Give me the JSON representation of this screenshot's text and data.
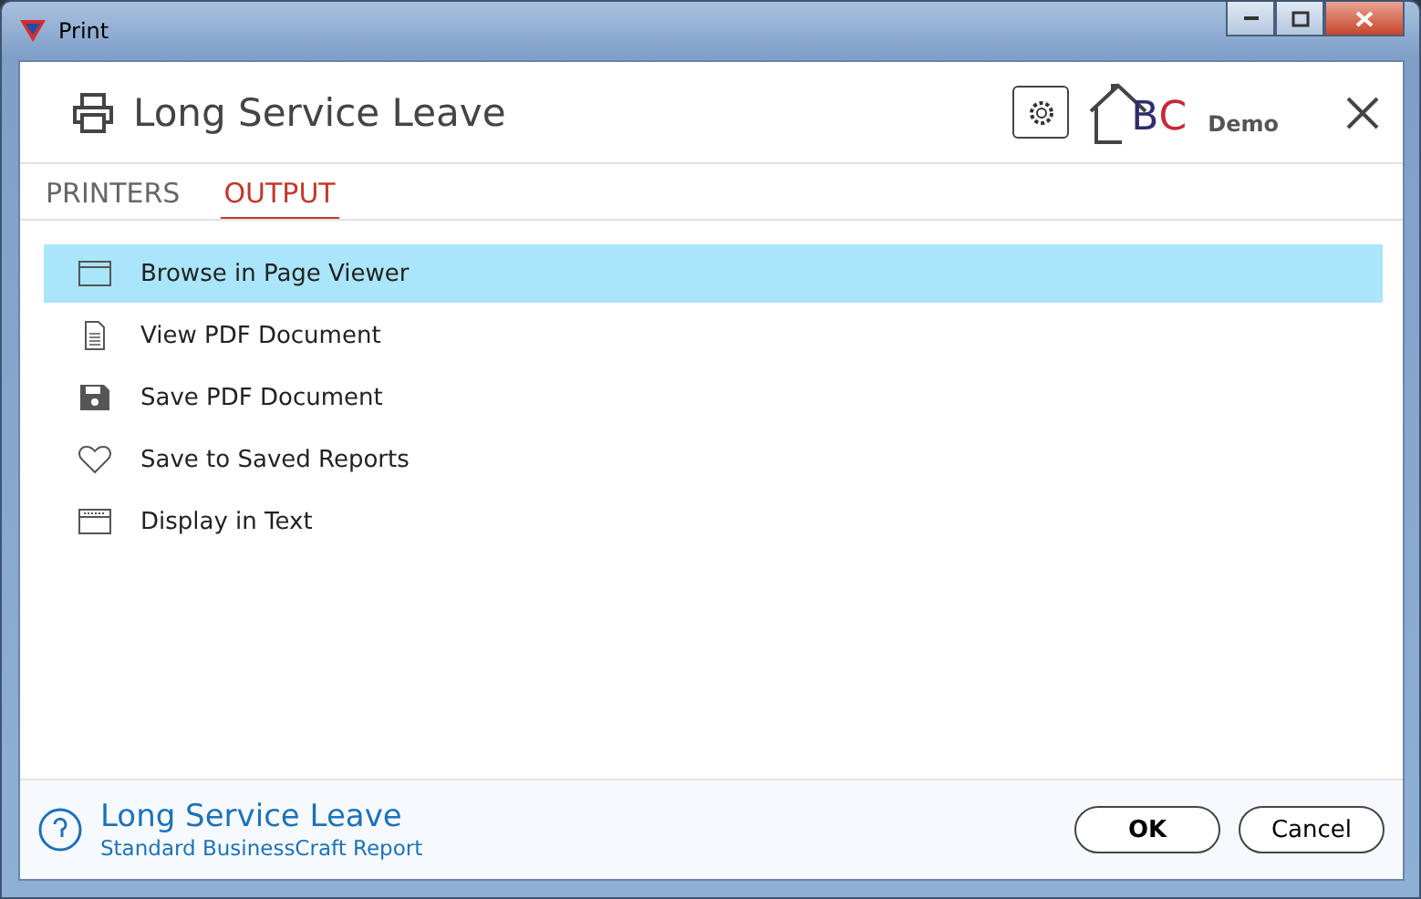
{
  "window": {
    "title": "Print"
  },
  "header": {
    "title": "Long Service Leave",
    "logo_letters": [
      "B",
      "C"
    ],
    "logo_caption": "Demo"
  },
  "tabs": [
    {
      "label": "PRINTERS",
      "selected": false
    },
    {
      "label": "OUTPUT",
      "selected": true
    }
  ],
  "options": [
    {
      "label": "Browse in Page Viewer",
      "kind": "window",
      "selected": true
    },
    {
      "label": "View PDF Document",
      "kind": "document",
      "selected": false
    },
    {
      "label": "Save PDF Document",
      "kind": "save",
      "selected": false
    },
    {
      "label": "Save to Saved Reports",
      "kind": "heart",
      "selected": false
    },
    {
      "label": "Display in Text",
      "kind": "text",
      "selected": false
    }
  ],
  "footer": {
    "title": "Long Service Leave",
    "subtitle": "Standard BusinessCraft Report",
    "buttons": [
      "OK",
      "Cancel"
    ]
  }
}
